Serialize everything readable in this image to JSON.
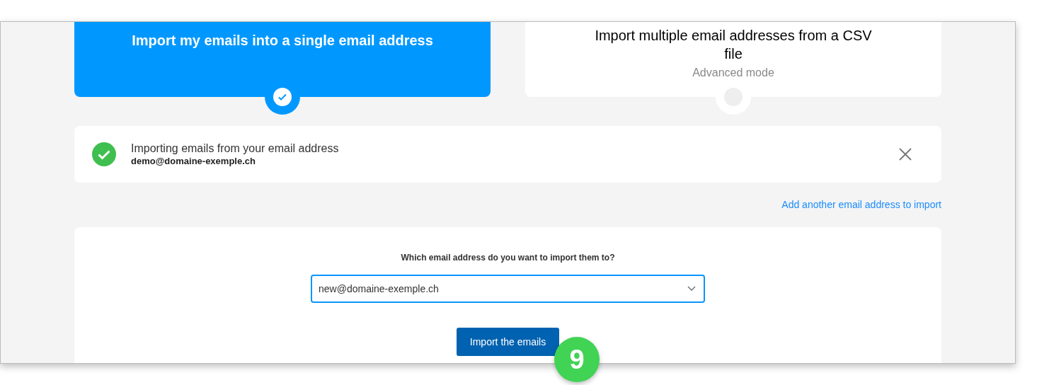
{
  "options": [
    {
      "title": "Import my emails into a single email address",
      "selected": true
    },
    {
      "title": "Import multiple email addresses from a CSV file",
      "subtitle": "Advanced mode",
      "selected": false
    }
  ],
  "source": {
    "message": "Importing emails from your email address",
    "address": "demo@domaine-exemple.ch"
  },
  "add_link": "Add another email address to import",
  "destination": {
    "question": "Which email address do you want to import them to?",
    "value": "new@domaine-exemple.ch"
  },
  "submit_button": "Import the emails",
  "step_badge": "9"
}
